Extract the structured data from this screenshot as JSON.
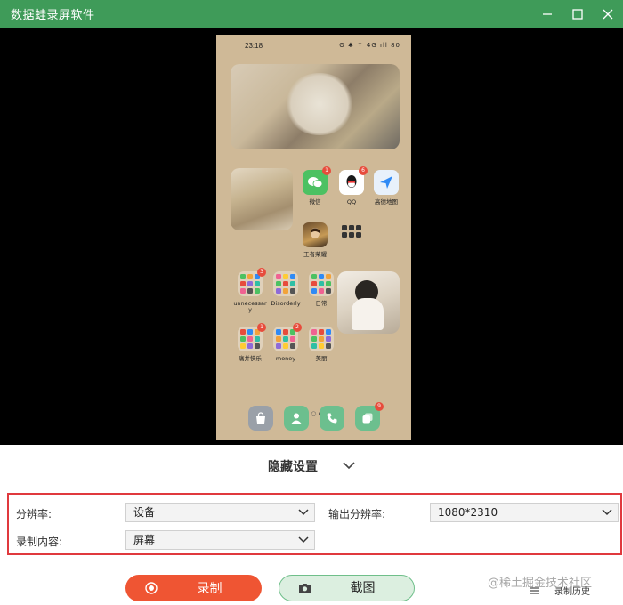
{
  "window": {
    "title": "数据蛙录屏软件",
    "accent": "#3f9b59"
  },
  "phone": {
    "status_time": "23:18",
    "status_icons": "ʘ ✱ ⌔ 4G ıll 80",
    "apps": {
      "wechat": {
        "label": "微信",
        "badge": "1"
      },
      "qq": {
        "label": "QQ",
        "badge": "6"
      },
      "amap": {
        "label": "高德地图"
      },
      "honor_of_kings": {
        "label": "王者荣耀"
      },
      "folder_unnecessary": {
        "label": "unnecessar\ny",
        "badge": "3"
      },
      "folder_disorderly": {
        "label": "Disorderly"
      },
      "folder_daily": {
        "label": "日常"
      },
      "folder_happy": {
        "label": "痛并快乐",
        "badge": "1"
      },
      "folder_money": {
        "label": "money",
        "badge": "2"
      },
      "folder_beauty": {
        "label": "美丽"
      }
    },
    "page_dots": "≡ ○ ●",
    "dock_badge": "9"
  },
  "hide_settings": {
    "label": "隐藏设置"
  },
  "settings": {
    "resolution_label": "分辨率:",
    "resolution_value": "设备",
    "output_resolution_label": "输出分辨率:",
    "output_resolution_value": "1080*2310",
    "content_label": "录制内容:",
    "content_value": "屏幕",
    "highlight_color": "#e0393e"
  },
  "actions": {
    "record_label": "录制",
    "screenshot_label": "截图",
    "history_label": "录制历史",
    "record_color": "#ef5533"
  },
  "watermark": "@稀土掘金技术社区"
}
